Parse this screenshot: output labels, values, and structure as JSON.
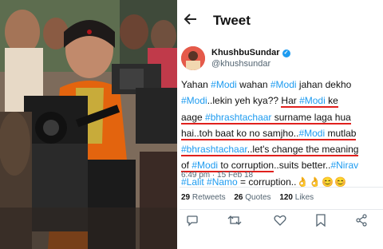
{
  "header": {
    "title": "Tweet"
  },
  "author": {
    "name": "KhushbuSundar",
    "handle": "@khushsundar"
  },
  "tweet": {
    "l1a": "Yahan ",
    "h_modi": "#Modi",
    "l1b": " wahan ",
    "l1c": " jahan dekho",
    "l2a": "..lekin yeh kya?? ",
    "u_har": "Har ",
    "u_keage": " ke",
    "u_aage": "aage ",
    "h_bhr1": "#bhrashtachaar",
    "u_surname": " surname laga hua",
    "u_hai": "hai..toh baat ko no samjho..",
    "u_mutlab": " mutlab",
    "h_bhr2": "#bhrashtachaar",
    "u_lets": "..let's change the meaning",
    "u_of": "of ",
    "u_tocorr": " to corruption",
    "l7a": "..suits better..",
    "h_nirav": "#Nirav",
    "h_lalit": "#Lalit",
    "h_namo": "#Namo",
    "l8a": " = corruption..",
    "emojis": "👌👌😊😊"
  },
  "meta": {
    "time": "6:49 pm",
    "dot": "·",
    "date": "15 Feb 18"
  },
  "stats": {
    "retweets_count": "29",
    "retweets_label": "Retweets",
    "quotes_count": "26",
    "quotes_label": "Quotes",
    "likes_count": "120",
    "likes_label": "Likes"
  },
  "colors": {
    "link": "#1d9bf0",
    "underline": "#e0201d",
    "muted": "#536471"
  },
  "icons": [
    "back-arrow-icon",
    "verified-icon",
    "reply-icon",
    "retweet-icon",
    "like-icon",
    "share-icon"
  ]
}
